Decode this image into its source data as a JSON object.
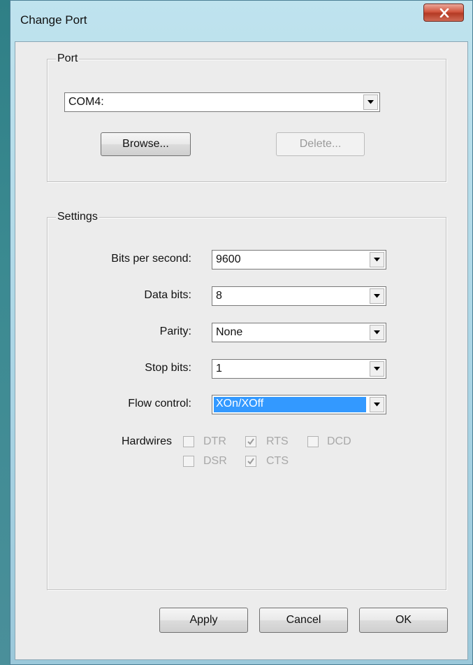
{
  "window": {
    "title": "Change Port"
  },
  "port_group": {
    "legend": "Port",
    "port_value": "COM4:",
    "browse_label": "Browse...",
    "delete_label": "Delete..."
  },
  "settings_group": {
    "legend": "Settings",
    "fields": [
      {
        "label": "Bits per second:",
        "value": "9600"
      },
      {
        "label": "Data bits:",
        "value": "8"
      },
      {
        "label": "Parity:",
        "value": "None"
      },
      {
        "label": "Stop bits:",
        "value": "1"
      },
      {
        "label": "Flow control:",
        "value": "XOn/XOff"
      }
    ],
    "hardwires_label": "Hardwires",
    "hardwires": [
      {
        "label": "DTR",
        "checked": false
      },
      {
        "label": "RTS",
        "checked": true
      },
      {
        "label": "DCD",
        "checked": false
      },
      {
        "label": "DSR",
        "checked": false
      },
      {
        "label": "CTS",
        "checked": true
      }
    ]
  },
  "footer": {
    "apply_label": "Apply",
    "cancel_label": "Cancel",
    "ok_label": "OK"
  },
  "colors": {
    "selection": "#3399ff",
    "close_button": "#c9462f"
  },
  "icons": [
    "close-icon",
    "dropdown-arrow-icon",
    "checkmark-icon"
  ]
}
